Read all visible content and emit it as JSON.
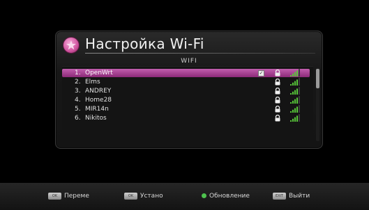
{
  "dialog": {
    "title": "Настройка Wi-Fi",
    "subtitle": "WIFI"
  },
  "networks": [
    {
      "num": "1.",
      "name": "OpenWrt",
      "checked": true,
      "signal_level": 4,
      "selected": true
    },
    {
      "num": "2.",
      "name": "Elms",
      "checked": false,
      "signal_level": 4,
      "selected": false
    },
    {
      "num": "3.",
      "name": "ANDREY",
      "checked": false,
      "signal_level": 4,
      "selected": false
    },
    {
      "num": "4.",
      "name": "Home28",
      "checked": false,
      "signal_level": 4,
      "selected": false
    },
    {
      "num": "5.",
      "name": "MIR14n",
      "checked": false,
      "signal_level": 4,
      "selected": false
    },
    {
      "num": "6.",
      "name": "Nikitos",
      "checked": false,
      "signal_level": 4,
      "selected": false
    }
  ],
  "footer": {
    "move": {
      "key": "OK",
      "label": "Переме"
    },
    "install": {
      "key": "OK",
      "label": "Устано"
    },
    "refresh": {
      "label": "Обновление"
    },
    "exit": {
      "key": "EXIT",
      "label": "Выйти"
    }
  },
  "colors": {
    "selection": "#b04a9c",
    "signal": "#59c93a",
    "refresh_dot": "#4ec24e"
  },
  "icons": [
    "star-logo-icon",
    "checkbox-icon",
    "lock-icon",
    "wifi-signal-icon",
    "remote-key-icon",
    "green-dot-icon"
  ]
}
